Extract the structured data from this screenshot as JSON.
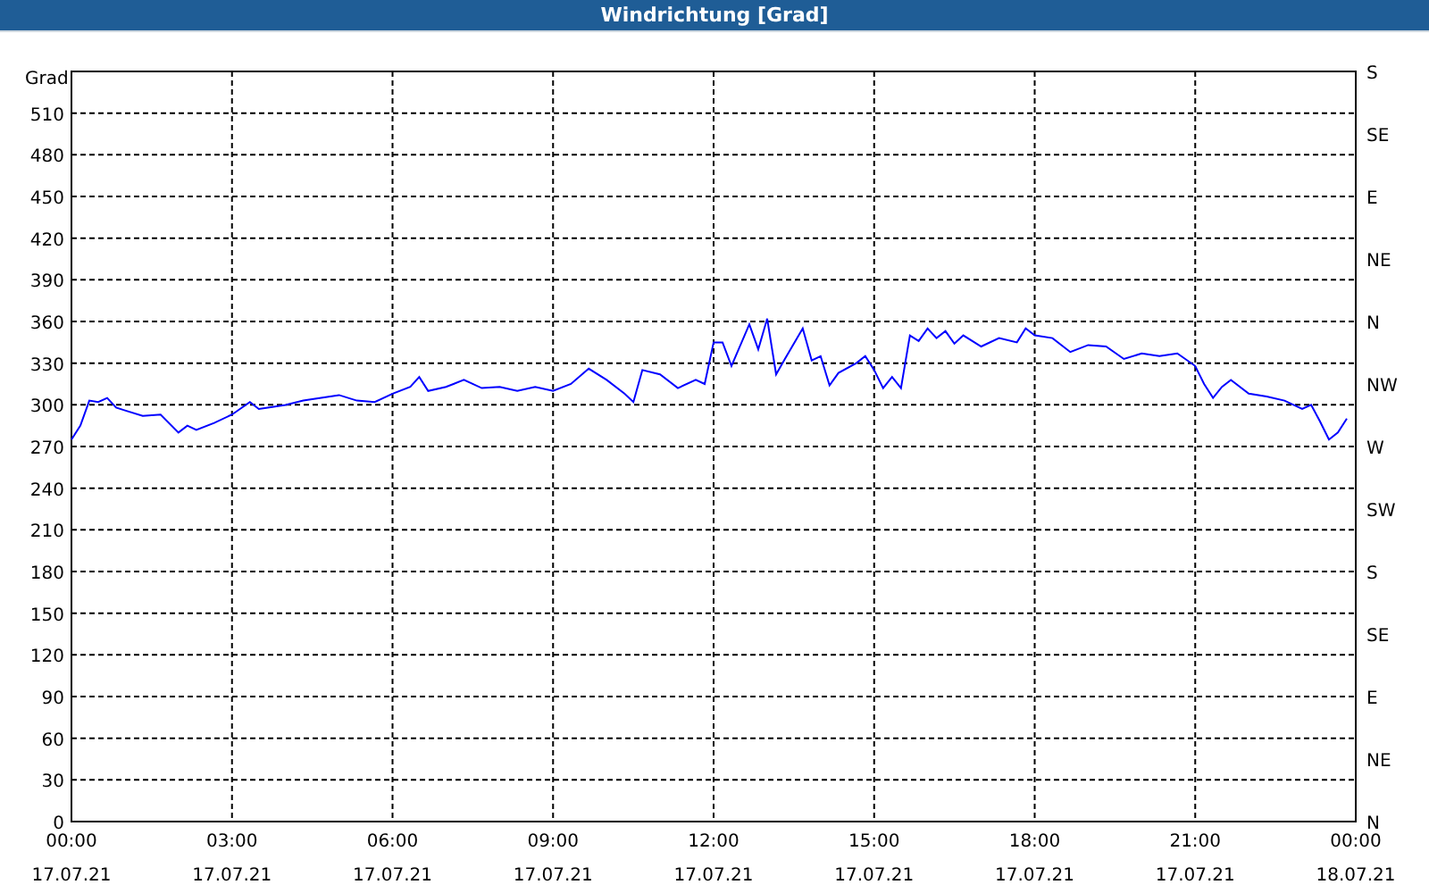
{
  "window": {
    "title": "Windrichtung [Grad]"
  },
  "chart": {
    "chart_data": {
      "type": "line",
      "ylabel": "Grad",
      "xlim": [
        0,
        24
      ],
      "ylim": [
        0,
        540
      ],
      "xticks": [
        {
          "value": 0,
          "label": "00:00"
        },
        {
          "value": 3,
          "label": "03:00"
        },
        {
          "value": 6,
          "label": "06:00"
        },
        {
          "value": 9,
          "label": "09:00"
        },
        {
          "value": 12,
          "label": "12:00"
        },
        {
          "value": 15,
          "label": "15:00"
        },
        {
          "value": 18,
          "label": "18:00"
        },
        {
          "value": 21,
          "label": "21:00"
        },
        {
          "value": 24,
          "label": "00:00"
        }
      ],
      "yticks": [
        0,
        30,
        60,
        90,
        120,
        150,
        180,
        210,
        240,
        270,
        300,
        330,
        360,
        390,
        420,
        450,
        480,
        510
      ],
      "x": [
        0,
        0.167,
        0.333,
        0.5,
        0.667,
        0.833,
        1,
        1.333,
        1.667,
        2,
        2.167,
        2.333,
        2.667,
        3,
        3.333,
        3.5,
        3.667,
        4,
        4.333,
        4.667,
        5,
        5.333,
        5.667,
        6,
        6.333,
        6.5,
        6.667,
        7,
        7.333,
        7.667,
        8,
        8.333,
        8.667,
        9,
        9.333,
        9.667,
        10,
        10.333,
        10.5,
        10.667,
        11,
        11.333,
        11.667,
        11.833,
        12,
        12.167,
        12.333,
        12.667,
        12.833,
        13,
        13.167,
        13.333,
        13.667,
        13.833,
        14,
        14.167,
        14.333,
        14.667,
        14.833,
        15,
        15.167,
        15.333,
        15.5,
        15.667,
        15.833,
        16,
        16.167,
        16.333,
        16.5,
        16.667,
        17,
        17.333,
        17.667,
        17.833,
        18,
        18.333,
        18.667,
        19,
        19.333,
        19.667,
        20,
        20.333,
        20.667,
        21,
        21.167,
        21.333,
        21.5,
        21.667,
        22,
        22.333,
        22.667,
        23,
        23.167,
        23.333,
        23.5,
        23.667,
        23.833
      ],
      "grid": true,
      "series": [
        {
          "color": "#0000ff",
          "values": [
            275,
            285,
            303,
            302,
            305,
            298,
            296,
            292,
            293,
            280,
            285,
            282,
            287,
            293,
            302,
            297,
            298,
            300,
            303,
            305,
            307,
            303,
            302,
            308,
            313,
            320,
            310,
            313,
            318,
            312,
            313,
            310,
            313,
            310,
            315,
            326,
            318,
            308,
            302,
            325,
            322,
            312,
            318,
            315,
            345,
            345,
            328,
            358,
            340,
            362,
            322,
            333,
            355,
            332,
            335,
            314,
            323,
            330,
            335,
            325,
            312,
            320,
            312,
            350,
            346,
            355,
            348,
            353,
            344,
            350,
            342,
            348,
            345,
            355,
            350,
            348,
            338,
            343,
            342,
            333,
            337,
            335,
            337,
            328,
            315,
            305,
            313,
            318,
            308,
            306,
            303,
            297,
            300,
            288,
            275,
            280,
            290
          ]
        }
      ]
    },
    "x_dates": [
      "17.07.21",
      "17.07.21",
      "17.07.21",
      "17.07.21",
      "17.07.21",
      "17.07.21",
      "17.07.21",
      "17.07.21",
      "18.07.21"
    ],
    "right_axis": [
      "S",
      "SE",
      "E",
      "NE",
      "N",
      "NW",
      "W",
      "SW",
      "S",
      "SE",
      "E",
      "NE",
      "N"
    ]
  }
}
